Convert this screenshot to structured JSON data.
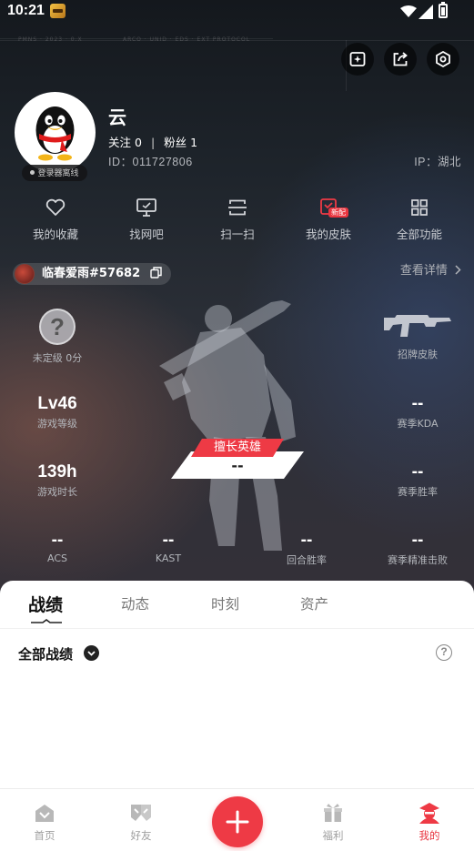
{
  "status_bar": {
    "time": "10:21"
  },
  "profile": {
    "nickname": "云",
    "follow_label": "关注",
    "follow_count": "0",
    "separator": "|",
    "fans_label": "粉丝",
    "fans_count": "1",
    "user_id": "ID：011727806",
    "ip_location": "IP：湖北",
    "online_status": "登录器离线"
  },
  "quick_actions": [
    {
      "label": "我的收藏",
      "icon": "heart-icon"
    },
    {
      "label": "找网吧",
      "icon": "monitor-icon"
    },
    {
      "label": "扫一扫",
      "icon": "scan-icon"
    },
    {
      "label": "我的皮肤",
      "icon": "skin-icon",
      "badge": "新配"
    },
    {
      "label": "全部功能",
      "icon": "grid-icon"
    }
  ],
  "game_account": {
    "name": "临春爱雨#57682",
    "detail_link": "查看详情"
  },
  "stats": {
    "rank": {
      "icon_text": "?",
      "label": "未定级 0分"
    },
    "skin": {
      "label": "招牌皮肤"
    },
    "level": {
      "value": "Lv46",
      "label": "游戏等级"
    },
    "kda": {
      "value": "--",
      "label": "赛季KDA"
    },
    "playtime": {
      "value": "139h",
      "label": "游戏时长"
    },
    "winrate": {
      "value": "--",
      "label": "赛季胜率"
    },
    "acs": {
      "value": "--",
      "label": "ACS"
    },
    "kast": {
      "value": "--",
      "label": "KAST"
    },
    "round_win": {
      "value": "--",
      "label": "回合胜率"
    },
    "headshot": {
      "value": "--",
      "label": "赛季精准击败"
    }
  },
  "best_hero": {
    "tag": "擅长英雄",
    "value": "--"
  },
  "tabs": [
    {
      "label": "战绩",
      "active": true
    },
    {
      "label": "动态",
      "active": false
    },
    {
      "label": "时刻",
      "active": false
    },
    {
      "label": "资产",
      "active": false
    }
  ],
  "filter": {
    "label": "全部战绩",
    "help_icon": "?"
  },
  "bottom_nav": [
    {
      "label": "首页",
      "icon": "home-icon",
      "active": false
    },
    {
      "label": "好友",
      "icon": "friends-icon",
      "active": false
    },
    {
      "label": "福利",
      "icon": "gift-icon",
      "active": false
    },
    {
      "label": "我的",
      "icon": "me-icon",
      "active": true
    }
  ],
  "colors": {
    "accent": "#ee3a45",
    "hero_bg": "#1e242b",
    "muted_text": "#b3b6bb"
  }
}
